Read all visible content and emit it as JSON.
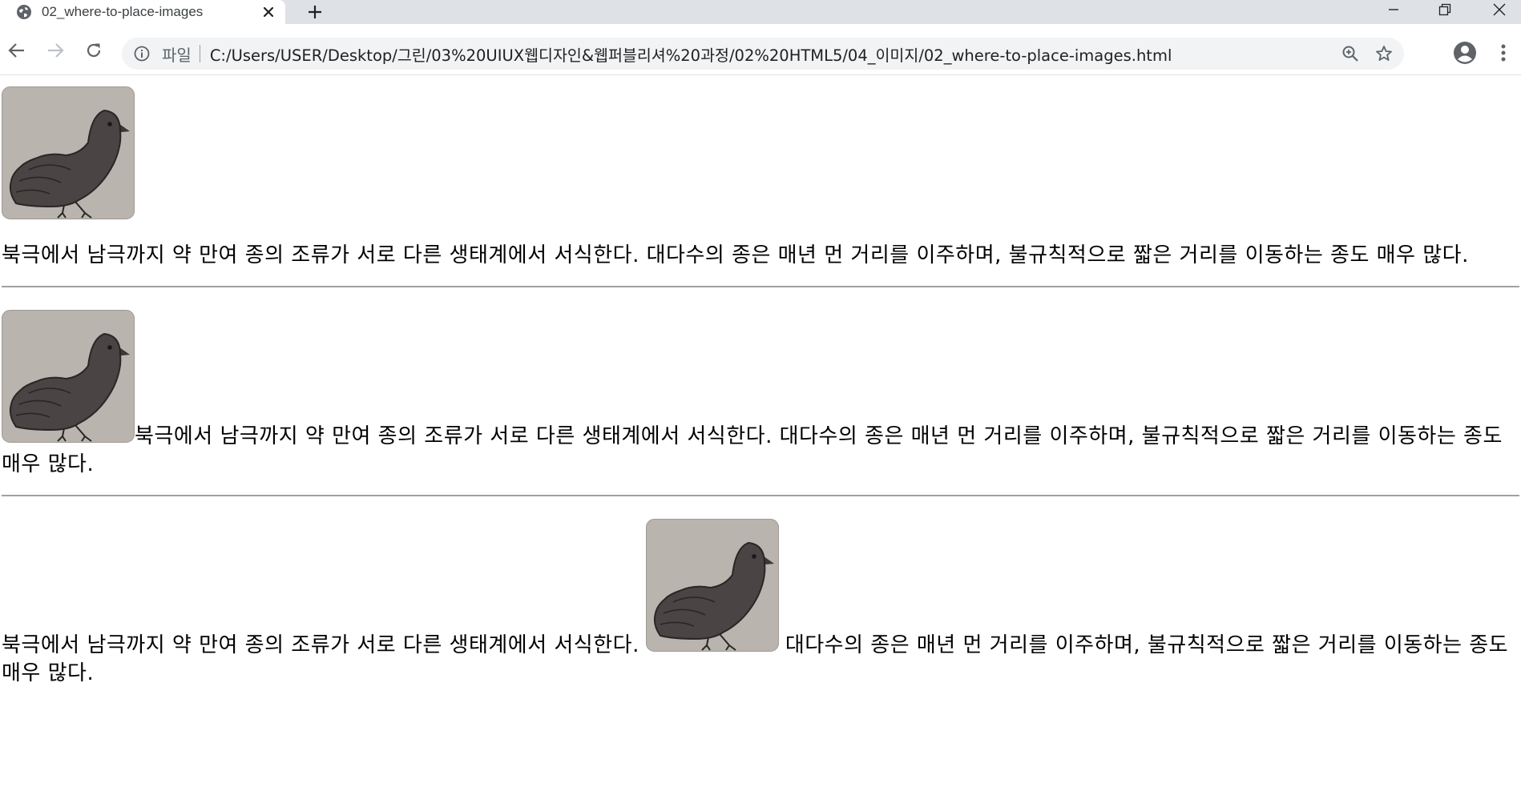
{
  "browser": {
    "tab": {
      "title": "02_where-to-place-images"
    },
    "omnibox": {
      "scheme_label": "파일",
      "url": "C:/Users/USER/Desktop/그린/03%20UIUX웹디자인&웹퍼블리셔%20과정/02%20HTML5/04_이미지/02_where-to-place-images.html"
    }
  },
  "page": {
    "sections": [
      {
        "text": "북극에서 남극까지 약 만여 종의 조류가 서로 다른 생태계에서 서식한다. 대다수의 종은 매년 먼 거리를 이주하며, 불규칙적으로 짧은 거리를 이동하는 종도 매우 많다."
      },
      {
        "text": "북극에서 남극까지 약 만여 종의 조류가 서로 다른 생태계에서 서식한다. 대다수의 종은 매년 먼 거리를 이주하며, 불규칙적으로 짧은 거리를 이동하는 종도 매우 많다."
      },
      {
        "text_before": "북극에서 남극까지 약 만여 종의 조류가 서로 다른 생태계에서 서식한다.",
        "text_after": "대다수의 종은 매년 먼 거리를 이주하며, 불규칙적으로 짧은 거리를 이동하는 종도 매우 많다."
      }
    ]
  },
  "colors": {
    "tabstrip": "#dee1e6",
    "omnibox": "#f1f3f4",
    "bird_bg": "#b9b4ae",
    "bird_body": "#4a4444",
    "rule": "#a0a0a0"
  },
  "icons": {
    "favicon": "globe-icon",
    "tab_close": "close-icon",
    "new_tab": "plus-icon",
    "back": "arrow-left-icon",
    "forward": "arrow-right-icon",
    "reload": "reload-icon",
    "info": "info-icon",
    "zoom": "zoom-icon",
    "bookmark": "star-icon",
    "profile": "account-icon",
    "menu": "kebab-menu-icon",
    "image": "bird-image"
  }
}
